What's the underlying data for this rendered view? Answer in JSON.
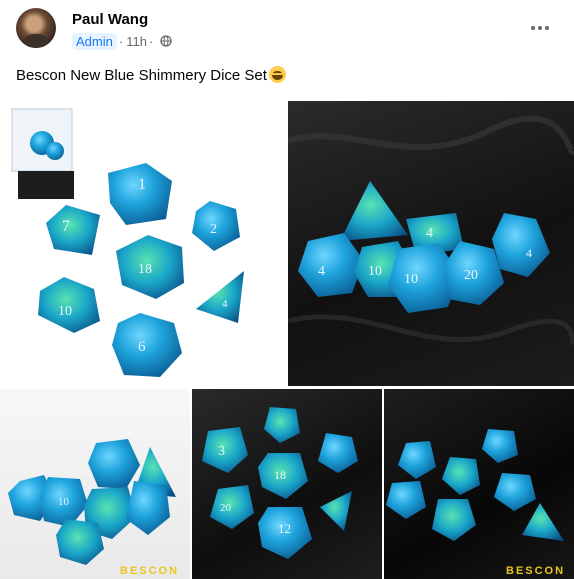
{
  "post": {
    "author": "Paul Wang",
    "role_badge": "Admin",
    "separator": "·",
    "time": "11h",
    "audience_icon": "globe-icon",
    "menu_icon": "more-options-icon",
    "text": "Bescon New Blue Shimmery Dice Set",
    "emoji": "grinning-face-emoji"
  },
  "photos": [
    {
      "id": "photo-1",
      "brand": ""
    },
    {
      "id": "photo-2",
      "brand": ""
    },
    {
      "id": "photo-3",
      "brand": "BESCON"
    },
    {
      "id": "photo-4",
      "brand": ""
    },
    {
      "id": "photo-5",
      "brand": "BESCON"
    }
  ],
  "colors": {
    "dice_blue": "#1e9fd6",
    "dice_glitter": "#3ad0a5",
    "badge_bg": "#e7f3ff",
    "badge_text": "#1877f2",
    "brand_text": "#e8c51e"
  }
}
